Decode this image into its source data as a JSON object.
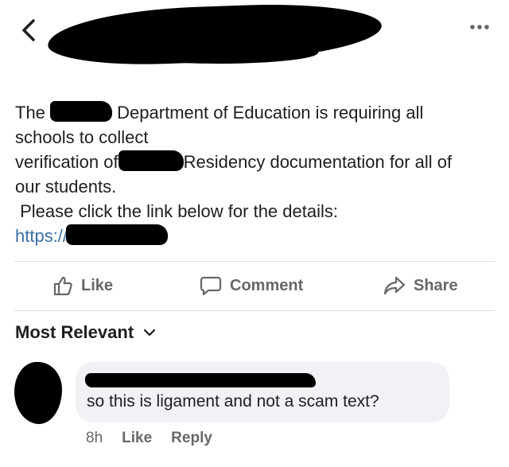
{
  "post": {
    "lines": [
      {
        "before": "The",
        "after": "Department of Education is requiring all"
      },
      {
        "text": "schools to collect"
      },
      {
        "before": "verification of",
        "after": "Residency documentation for all of"
      },
      {
        "text": "our students."
      },
      {
        "text": " Please click the link below for the details:"
      },
      {
        "link": "https://"
      }
    ]
  },
  "actions": {
    "like": {
      "label": "Like",
      "icon": "thumbs-up-icon"
    },
    "comment": {
      "label": "Comment",
      "icon": "speech-bubble-icon"
    },
    "share": {
      "label": "Share",
      "icon": "share-arrow-icon"
    }
  },
  "comments_sort": {
    "label": "Most Relevant",
    "icon": "chevron-down-icon"
  },
  "comment": {
    "text": "so this is ligament and not a scam text?",
    "time": "8h",
    "like_label": "Like",
    "reply_label": "Reply"
  },
  "colors": {
    "link": "#3b6ea8",
    "action_text": "#65676b",
    "bubble_bg": "#f0f2f5",
    "redaction": "#000000"
  }
}
